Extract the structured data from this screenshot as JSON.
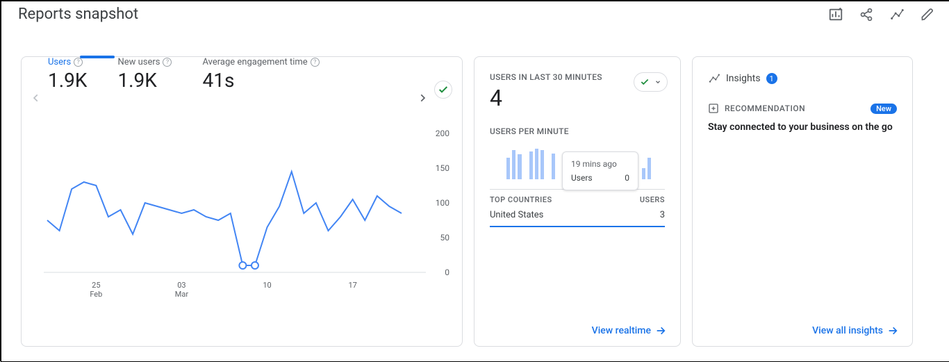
{
  "header": {
    "title": "Reports snapshot"
  },
  "main_card": {
    "metrics": [
      {
        "label": "Users",
        "value": "1.9K",
        "active": true
      },
      {
        "label": "New users",
        "value": "1.9K",
        "active": false
      },
      {
        "label": "Average engagement time",
        "value": "41s",
        "active": false
      }
    ]
  },
  "chart_data": {
    "type": "line",
    "title": "",
    "xlabel": "",
    "ylabel": "",
    "ylim": [
      0,
      200
    ],
    "y_ticks": [
      0,
      50,
      100,
      150,
      200
    ],
    "x_ticks": [
      {
        "day": "25",
        "month": "Feb"
      },
      {
        "day": "03",
        "month": "Mar"
      },
      {
        "day": "10",
        "month": ""
      },
      {
        "day": "17",
        "month": ""
      }
    ],
    "series": [
      {
        "name": "Users",
        "color": "#4285f4",
        "values": [
          75,
          60,
          120,
          130,
          125,
          80,
          90,
          55,
          100,
          95,
          90,
          85,
          90,
          80,
          75,
          85,
          10,
          10,
          65,
          95,
          145,
          85,
          100,
          60,
          80,
          105,
          75,
          110,
          95,
          85
        ]
      }
    ],
    "highlight_indices": [
      16,
      17
    ]
  },
  "realtime": {
    "title": "USERS IN LAST 30 MINUTES",
    "value": "4",
    "per_minute_label": "USERS PER MINUTE",
    "bars": [
      0,
      0,
      0,
      30,
      40,
      35,
      0,
      38,
      42,
      40,
      0,
      36,
      0,
      34,
      0,
      0,
      0,
      0,
      0,
      0,
      0,
      0,
      0,
      0,
      0,
      0,
      0,
      15,
      30,
      0
    ],
    "top_countries_label": "TOP COUNTRIES",
    "users_col_label": "USERS",
    "rows": [
      {
        "country": "United States",
        "users": "3"
      }
    ],
    "tooltip": {
      "time": "19 mins ago",
      "label": "Users",
      "value": "0"
    },
    "footer": "View realtime"
  },
  "insights": {
    "title": "Insights",
    "count": "1",
    "recommendation_label": "RECOMMENDATION",
    "new_badge": "New",
    "recommendation_text": "Stay connected to your business on the go",
    "footer": "View all insights"
  }
}
